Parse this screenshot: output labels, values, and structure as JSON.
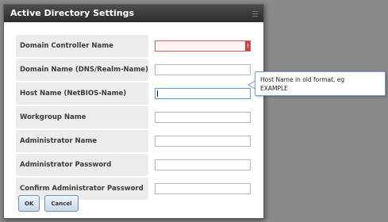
{
  "dialog": {
    "title": "Active Directory Settings"
  },
  "form": {
    "fields": [
      {
        "label": "Domain Controller Name",
        "value": "",
        "state": "error"
      },
      {
        "label": "Domain Name (DNS/Realm-Name)",
        "value": "",
        "state": "normal"
      },
      {
        "label": "Host Name (NetBIOS-Name)",
        "value": "",
        "state": "focused"
      },
      {
        "label": "Workgroup Name",
        "value": "",
        "state": "normal"
      },
      {
        "label": "Administrator Name",
        "value": "",
        "state": "normal"
      },
      {
        "label": "Administrator Password",
        "value": "",
        "state": "normal"
      },
      {
        "label": "Confirm Administrator Password",
        "value": "",
        "state": "normal"
      }
    ]
  },
  "buttons": {
    "ok_label": "OK",
    "cancel_label": "Cancel"
  },
  "tooltip": {
    "line1": "Host Name in old format, eg",
    "line2": "EXAMPLE"
  },
  "colors": {
    "titlebar": "#3a3a3a",
    "error_border": "#d06060",
    "focus_border": "#5a9ad6",
    "button_border": "#6f8fb8"
  }
}
